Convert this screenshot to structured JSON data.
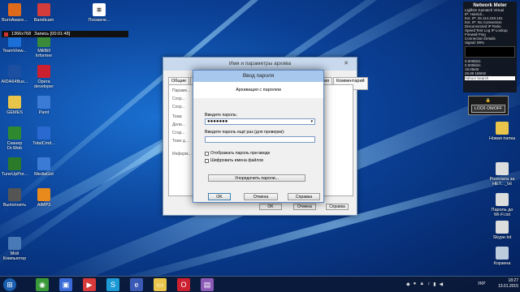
{
  "desktop_icons_left": [
    {
      "label": "BurnAware...",
      "icon": "flame-icon",
      "color": "#e06a1c"
    },
    {
      "label": "Bandicam",
      "icon": "bandicam-icon",
      "color": "#d43b3b"
    },
    {
      "label": "TeamView...",
      "icon": "teamviewer-icon",
      "color": "#1c6fd6"
    },
    {
      "label": "MiliBill\nInformer",
      "icon": "informer-icon",
      "color": "#3a8a3a"
    },
    {
      "label": "AIDA64Bus...",
      "icon": "aida64-icon",
      "color": "#1c4fa0"
    },
    {
      "label": "Opera\ndeveloper",
      "icon": "opera-icon",
      "color": "#cc1f2f"
    },
    {
      "label": "GEMES",
      "icon": "folder-icon",
      "color": "#e8c44a"
    },
    {
      "label": "Paint",
      "icon": "paint-icon",
      "color": "#3b7bd6"
    },
    {
      "label": "Сканер\nDr.Web",
      "icon": "drweb-icon",
      "color": "#2f8a2f"
    },
    {
      "label": "TotalCmd...",
      "icon": "totalcmd-icon",
      "color": "#2a6ad0"
    },
    {
      "label": "TuneUpPor...",
      "icon": "tuneup-icon",
      "color": "#2a7a2a"
    },
    {
      "label": "MediaGet",
      "icon": "mediaget-icon",
      "color": "#3b7bd6"
    },
    {
      "label": "Выполнить",
      "icon": "run-icon",
      "color": "#555"
    },
    {
      "label": "AIMP3",
      "icon": "aimp-icon",
      "color": "#e88a1c"
    },
    {
      "label": "Мой\nКомпьютер",
      "icon": "computer-icon",
      "color": "#4a7ab6"
    }
  ],
  "desktop_icons_right": [
    {
      "label": "Новая папка",
      "icon": "folder-icon",
      "color": "#e8c44a"
    },
    {
      "label": "Розплата за\nНЕТ..._txt",
      "icon": "text-file-icon",
      "color": "#ddd"
    },
    {
      "label": "Пароль до\nWi-Fi.txt",
      "icon": "text-file-icon",
      "color": "#ddd"
    },
    {
      "label": "Skype.txt",
      "icon": "text-file-icon",
      "color": "#ddd"
    },
    {
      "label": "Корзина",
      "icon": "recycle-bin-icon",
      "color": "#bcd"
    }
  ],
  "top_icon": {
    "label": "Посмаче...",
    "icon": "document-icon"
  },
  "recording_bar": {
    "resolution": "1366x768",
    "status": "Запись [00:01:48]"
  },
  "network_meter": {
    "title": "Network Meter",
    "lines": [
      "Ligilhim Kamatch Virtual",
      "IP: Hamidi...",
      "Ext. IP: 25.114.228.161",
      "Ext. IP: No Connection",
      "Disconnected IP Ratio",
      "Speed Test   Log   IP Lookup",
      "Firewall    Ping",
      "Connection Details",
      "Signal: 99%"
    ],
    "speeds": [
      "0.000kb/s",
      "0.000kb/s"
    ],
    "totals": [
      "19.05KB",
      "26.89 186KB"
    ],
    "search": "Yahoo! Search"
  },
  "lock_gadget": {
    "label": "LOCK ON/OFF"
  },
  "bg_window": {
    "title": "Имя и параметры архива",
    "tabs": [
      "Общие",
      "Дополнительно",
      "Параметры",
      "Файлы",
      "Резервные копии",
      "Время",
      "Комментарий"
    ],
    "side_labels": [
      "Параме...",
      "Сохр...",
      "Сохр...",
      "Тома",
      "Дели...",
      "Стар...",
      "Тоже д...",
      "Информ..."
    ],
    "buttons": [
      "OK",
      "Отмена",
      "Справка"
    ]
  },
  "dialog": {
    "title": "Ввод пароля",
    "header": "Архивация с паролем",
    "password_label": "Введите пароль:",
    "password_value": "●●●●●●●",
    "confirm_label": "Введите пароль ещё раз (для проверки):",
    "confirm_value": "",
    "show_password": "Отображать пароль при вводе",
    "encrypt_names": "Шифровать имена файлов",
    "organize_button": "Упорядочить пароли...",
    "ok": "OK",
    "cancel": "Отмена",
    "help": "Справка"
  },
  "taskbar": {
    "apps": [
      {
        "icon": "chrome-icon",
        "color": "#3a9a3a"
      },
      {
        "icon": "floppy-icon",
        "color": "#3a6ad6"
      },
      {
        "icon": "media-icon",
        "color": "#d63a3a"
      },
      {
        "icon": "skype-icon",
        "color": "#1c9ad6"
      },
      {
        "icon": "explorer-icon",
        "color": "#3a5ab6"
      },
      {
        "icon": "folder-icon",
        "color": "#e8c44a"
      },
      {
        "icon": "opera-icon",
        "color": "#cc1f2f"
      },
      {
        "icon": "archive-icon",
        "color": "#8a5ab6"
      }
    ],
    "lang": "УКР",
    "time": "18:27",
    "date": "13.01.2015"
  }
}
